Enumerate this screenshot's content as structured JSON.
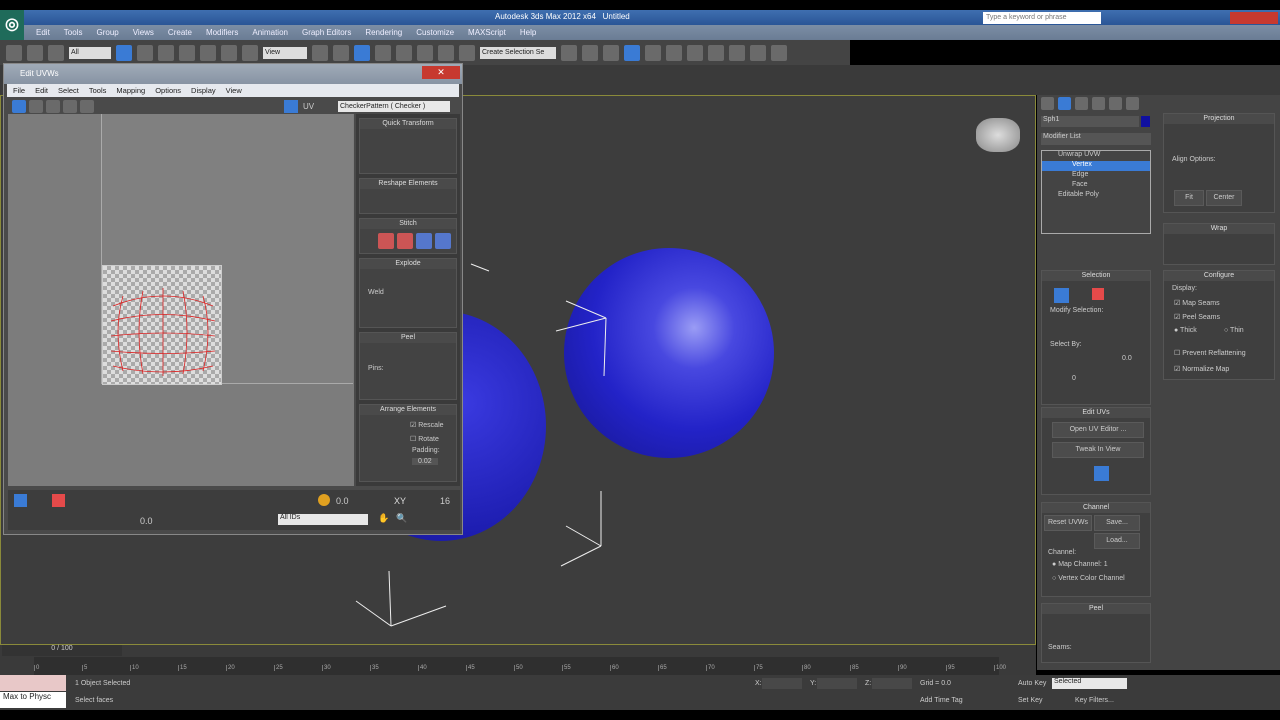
{
  "app": {
    "title": "Autodesk 3ds Max 2012 x64",
    "doc": "Untitled",
    "search_placeholder": "Type a keyword or phrase"
  },
  "menu": [
    "Edit",
    "Tools",
    "Group",
    "Views",
    "Create",
    "Modifiers",
    "Animation",
    "Graph Editors",
    "Rendering",
    "Customize",
    "MAXScript",
    "Help"
  ],
  "toolbar": {
    "filter": "All",
    "ref_coord": "View",
    "selection_set": "Create Selection Se"
  },
  "uvw": {
    "title": "Edit UVWs",
    "menu": [
      "File",
      "Edit",
      "Select",
      "Tools",
      "Mapping",
      "Options",
      "Display",
      "View"
    ],
    "uv_label": "UV",
    "texture": "CheckerPattern  ( Checker )",
    "sections": {
      "quick": "Quick Transform",
      "reshape": "Reshape Elements",
      "stitch": "Stitch",
      "explode": "Explode",
      "weld": "Weld",
      "peel": "Peel",
      "pins": "Pins:",
      "arrange": "Arrange Elements",
      "rescale": "Rescale",
      "rotate": "Rotate",
      "padding": "Padding:",
      "padding_val": "0.02"
    },
    "bottom": {
      "soft_val": "0.0",
      "xy": "XY",
      "grid_val": "16",
      "w_val": "0.0",
      "ids": "All IDs"
    }
  },
  "cmd": {
    "object_name": "Sph1",
    "modifier_list": "Modifier List",
    "stack": [
      "Unwrap UVW",
      "Vertex",
      "Edge",
      "Face",
      "Editable Poly"
    ],
    "selection": "Selection",
    "modify_selection": "Modify Selection:",
    "select_by": "Select By:",
    "select_by_val": "0.0",
    "select_by_val2": "0",
    "edit_uvs": "Edit UVs",
    "open_uv_editor": "Open UV Editor ...",
    "tweak": "Tweak In View",
    "channel": "Channel",
    "reset_uvws": "Reset UVWs",
    "save": "Save...",
    "load": "Load...",
    "channel_group": "Channel:",
    "map_channel": "Map Channel:",
    "map_channel_val": "1",
    "vertex_color": "Vertex Color Channel",
    "peel": "Peel",
    "seams": "Seams:",
    "projection": "Projection",
    "align_options": "Align Options:",
    "fit": "Fit",
    "center": "Center",
    "wrap": "Wrap",
    "configure": "Configure",
    "display": "Display:",
    "map_seams": "Map Seams",
    "peel_seams": "Peel Seams",
    "thick": "Thick",
    "thin": "Thin",
    "prevent_reflattening": "Prevent Reflattening",
    "normalize_map": "Normalize Map"
  },
  "timeline": {
    "frame": "0 / 100",
    "ticks": [
      "0",
      "5",
      "10",
      "15",
      "20",
      "25",
      "30",
      "35",
      "40",
      "45",
      "50",
      "55",
      "60",
      "65",
      "70",
      "75",
      "80",
      "85",
      "90",
      "95",
      "100"
    ]
  },
  "status": {
    "selected": "1 Object Selected",
    "prompt": "Select faces",
    "grid": "Grid = 0.0",
    "add_time_tag": "Add Time Tag",
    "auto_key": "Auto Key",
    "set_key": "Set Key",
    "key_mode": "Selected",
    "key_filters": "Key Filters...",
    "maxscript": "Max to Physc",
    "x": "X:",
    "y": "Y:",
    "z": "Z:"
  },
  "colors": {
    "accent": "#3a7bd5",
    "sphere": "#2a2ad0",
    "viewport_border": "#8a8a3a"
  }
}
